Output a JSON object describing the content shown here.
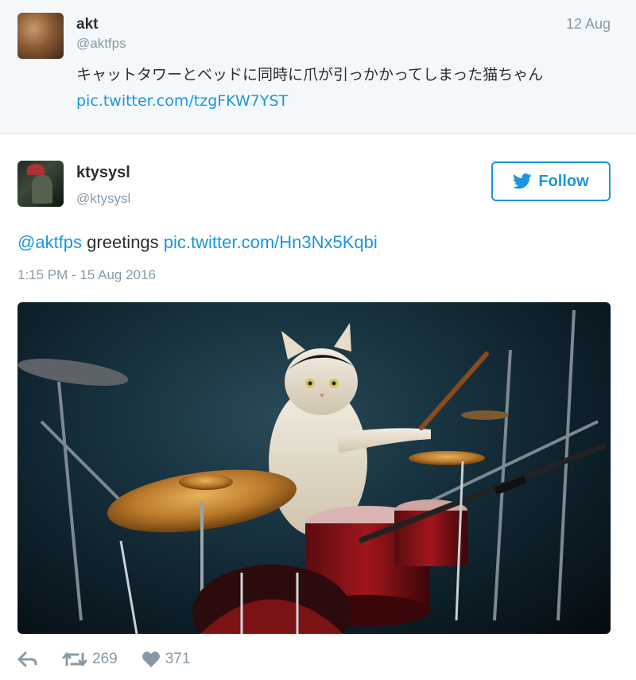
{
  "parent_tweet": {
    "author_name": "akt",
    "author_handle": "@aktfps",
    "date": "12 Aug",
    "text": "キャットタワーとベッドに同時に爪が引っかかってしまった猫ちゃん",
    "link": "pic.twitter.com/tzgFKW7YST"
  },
  "tweet": {
    "author_name": "ktysysl",
    "author_handle": "@ktysysl",
    "follow_label": "Follow",
    "mention": "@aktfps",
    "body": "greetings",
    "link": "pic.twitter.com/Hn3Nx5Kqbi",
    "timestamp": "1:15 PM - 15 Aug 2016",
    "retweet_count": "269",
    "like_count": "371"
  },
  "colors": {
    "link": "#1b95e0",
    "muted": "#8899a6",
    "parent_bg": "#f5f8fa"
  },
  "icons": {
    "follow": "twitter-bird-icon",
    "reply": "reply-icon",
    "retweet": "retweet-icon",
    "like": "heart-icon"
  }
}
